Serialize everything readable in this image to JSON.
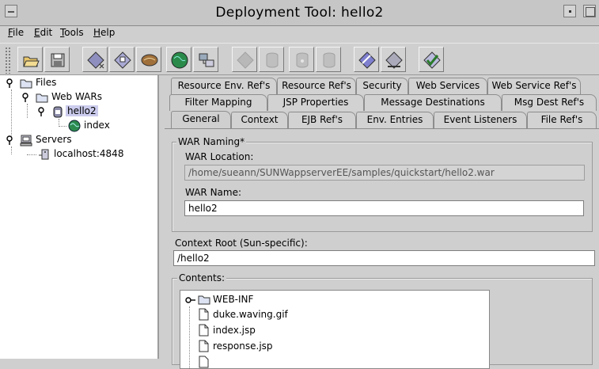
{
  "window": {
    "title": "Deployment Tool: hello2"
  },
  "menu": [
    {
      "label": "File",
      "mnemonic": "F",
      "rest": "ile"
    },
    {
      "label": "Edit",
      "mnemonic": "E",
      "rest": "dit"
    },
    {
      "label": "Tools",
      "mnemonic": "T",
      "rest": "ools"
    },
    {
      "label": "Help",
      "mnemonic": "H",
      "rest": "elp"
    }
  ],
  "toolbar": {
    "buttons": [
      {
        "icon": "open-folder-icon",
        "enabled": true
      },
      {
        "icon": "save-disk-icon",
        "enabled": true
      },
      {
        "icon": "new-application-icon",
        "enabled": true
      },
      {
        "icon": "new-web-component-icon",
        "enabled": true
      },
      {
        "icon": "new-bean-icon",
        "enabled": true
      },
      {
        "icon": "new-app-client-icon",
        "enabled": true
      },
      {
        "icon": "new-connector-icon",
        "enabled": true
      },
      {
        "icon": "deploy-icon",
        "enabled": false
      },
      {
        "icon": "add-db-icon",
        "enabled": false
      },
      {
        "icon": "db-config-icon",
        "enabled": false
      },
      {
        "icon": "db-remove-icon",
        "enabled": false
      },
      {
        "icon": "update-verify-icon",
        "enabled": true
      },
      {
        "icon": "undeploy-icon",
        "enabled": true
      },
      {
        "icon": "verify-checkmark-icon",
        "enabled": true
      }
    ]
  },
  "tree": {
    "files_label": "Files",
    "webwars_label": "Web WARs",
    "hello2_label": "hello2",
    "index_label": "index",
    "servers_label": "Servers",
    "localhost_label": "localhost:4848"
  },
  "tabs": {
    "row1": [
      "Resource Env. Ref's",
      "Resource Ref's",
      "Security",
      "Web Services",
      "Web Service Ref's"
    ],
    "row2": [
      "Filter Mapping",
      "JSP Properties",
      "Message Destinations",
      "Msg Dest Ref's"
    ],
    "row3": [
      "General",
      "Context",
      "EJB Ref's",
      "Env. Entries",
      "Event Listeners",
      "File Ref's"
    ],
    "active": "General"
  },
  "general": {
    "war_naming_title": "WAR Naming*",
    "war_location_label": "WAR Location:",
    "war_location_value": "/home/sueann/SUNWappserverEE/samples/quickstart/hello2.war",
    "war_name_label": "WAR Name:",
    "war_name_value": "hello2",
    "context_root_label": "Context Root (Sun-specific):",
    "context_root_value": "/hello2",
    "contents_title": "Contents:",
    "contents": {
      "folder": "WEB-INF",
      "files": [
        "duke.waving.gif",
        "index.jsp",
        "response.jsp"
      ]
    }
  },
  "colors": {
    "background": "#cfcfcf",
    "tree_background": "#ffffff",
    "selection": "#ccccee",
    "field_readonly": "#d4d4d4"
  }
}
